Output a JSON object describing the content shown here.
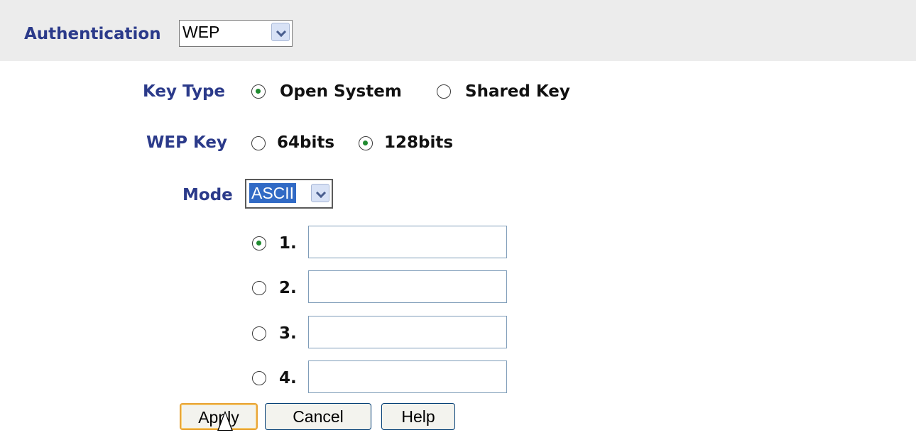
{
  "auth": {
    "label": "Authentication",
    "value": "WEP"
  },
  "key_type": {
    "label": "Key Type",
    "options": [
      {
        "label": "Open System",
        "checked": true
      },
      {
        "label": "Shared Key",
        "checked": false
      }
    ]
  },
  "wep_key": {
    "label": "WEP Key",
    "options": [
      {
        "label": "64bits",
        "checked": false
      },
      {
        "label": "128bits",
        "checked": true
      }
    ]
  },
  "mode": {
    "label": "Mode",
    "value": "ASCII"
  },
  "keys": [
    {
      "label": "1.",
      "checked": true,
      "value": ""
    },
    {
      "label": "2.",
      "checked": false,
      "value": ""
    },
    {
      "label": "3.",
      "checked": false,
      "value": ""
    },
    {
      "label": "4.",
      "checked": false,
      "value": ""
    }
  ],
  "buttons": {
    "apply": "Apply",
    "cancel": "Cancel",
    "help": "Help"
  },
  "colors": {
    "label": "#2b3a8a",
    "radio_dot": "#1f8a2f",
    "topbar": "#ececec",
    "selected_bg": "#316ac5"
  }
}
